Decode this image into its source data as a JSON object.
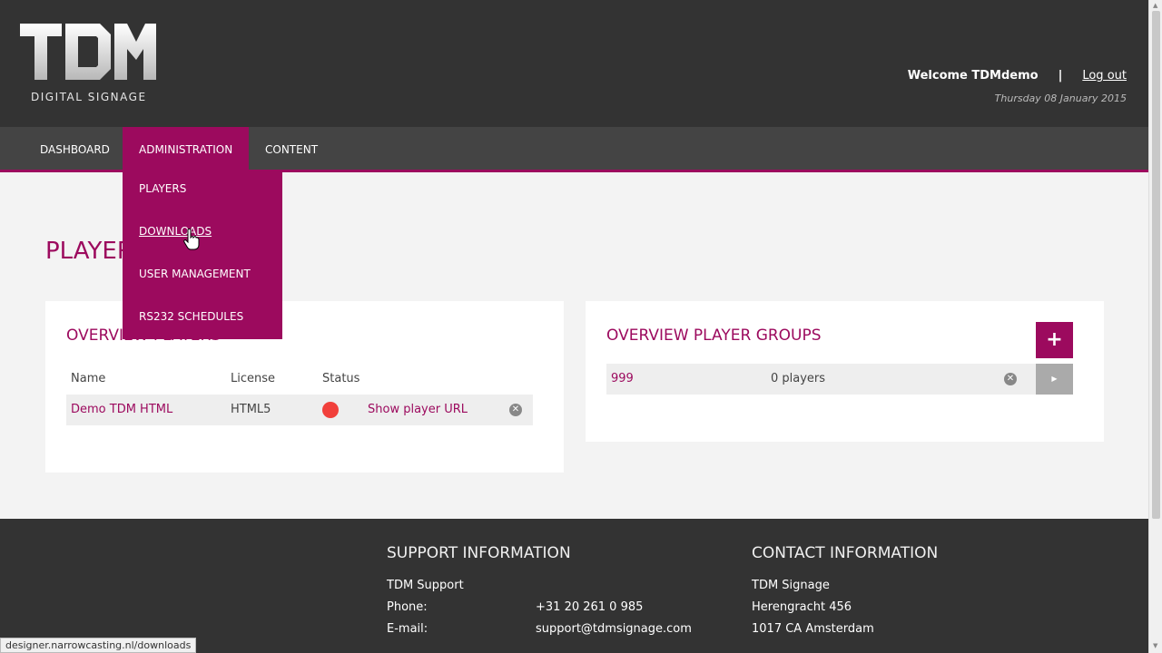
{
  "header": {
    "logo_text": "TDM",
    "logo_subtitle": "DIGITAL SIGNAGE",
    "welcome": "Welcome TDMdemo",
    "separator": "|",
    "logout": "Log out",
    "date": "Thursday 08 January 2015"
  },
  "nav": {
    "items": [
      {
        "label": "DASHBOARD"
      },
      {
        "label": "ADMINISTRATION"
      },
      {
        "label": "CONTENT"
      }
    ],
    "dropdown": [
      {
        "label": "PLAYERS"
      },
      {
        "label": "DOWNLOADS"
      },
      {
        "label": "USER MANAGEMENT"
      },
      {
        "label": "RS232 SCHEDULES"
      }
    ]
  },
  "page": {
    "title": "PLAYERS"
  },
  "players_panel": {
    "title": "OVERVIEW PLAYERS",
    "columns": [
      "Name",
      "License",
      "Status"
    ],
    "rows": [
      {
        "name": "Demo TDM HTML",
        "license": "HTML5",
        "status_color": "#f1403b",
        "action": "Show player URL"
      }
    ]
  },
  "groups_panel": {
    "title": "OVERVIEW PLAYER GROUPS",
    "add_label": "+",
    "rows": [
      {
        "name": "999",
        "count": "0 players"
      }
    ]
  },
  "footer": {
    "support_title": "SUPPORT INFORMATION",
    "support_name": "TDM Support",
    "phone_label": "Phone:",
    "phone": "+31 20 261 0 985",
    "email_label": "E-mail:",
    "email": "support@tdmsignage.com",
    "contact_title": "CONTACT INFORMATION",
    "company": "TDM Signage",
    "street": "Herengracht 456",
    "city": "1017 CA Amsterdam"
  },
  "statusbar": {
    "url": "designer.narrowcasting.nl/downloads"
  },
  "colors": {
    "accent": "#9c0a5e",
    "header_bg": "#333333",
    "nav_bg": "#444444",
    "status_offline": "#f1403b"
  }
}
